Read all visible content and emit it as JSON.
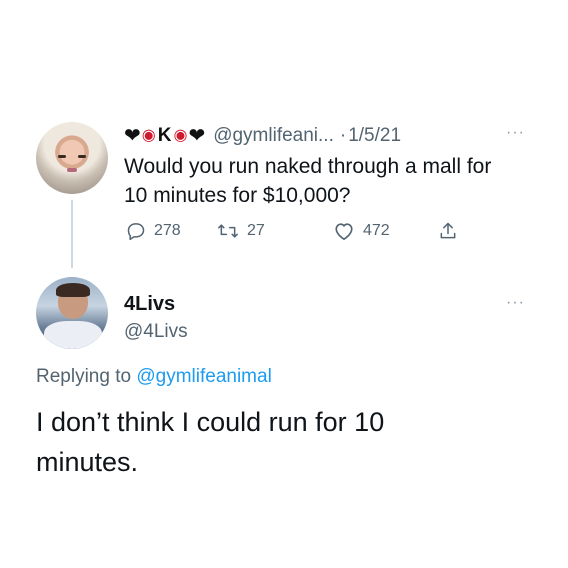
{
  "parent_tweet": {
    "display_name_letter": "K",
    "handle": "@gymlifeani...",
    "separator": "·",
    "date": "1/5/21",
    "more": "···",
    "text_lines": [
      "Would you run naked through a mall for",
      "10 minutes for $10,000?"
    ],
    "stats": {
      "replies": "278",
      "retweets": "27",
      "likes": "472"
    }
  },
  "reply_tweet": {
    "name": "4Livs",
    "handle": "@4Livs",
    "more": "···",
    "replying_prefix": "Replying to",
    "replying_to": "@gymlifeanimal",
    "text_lines": [
      "I don’t think I could run for 10",
      "minutes."
    ]
  },
  "colors": {
    "secondary_text": "#536471",
    "link": "#1d9bf0",
    "kiss_emoji": "#d0192d",
    "heart_emoji": "#111111"
  }
}
